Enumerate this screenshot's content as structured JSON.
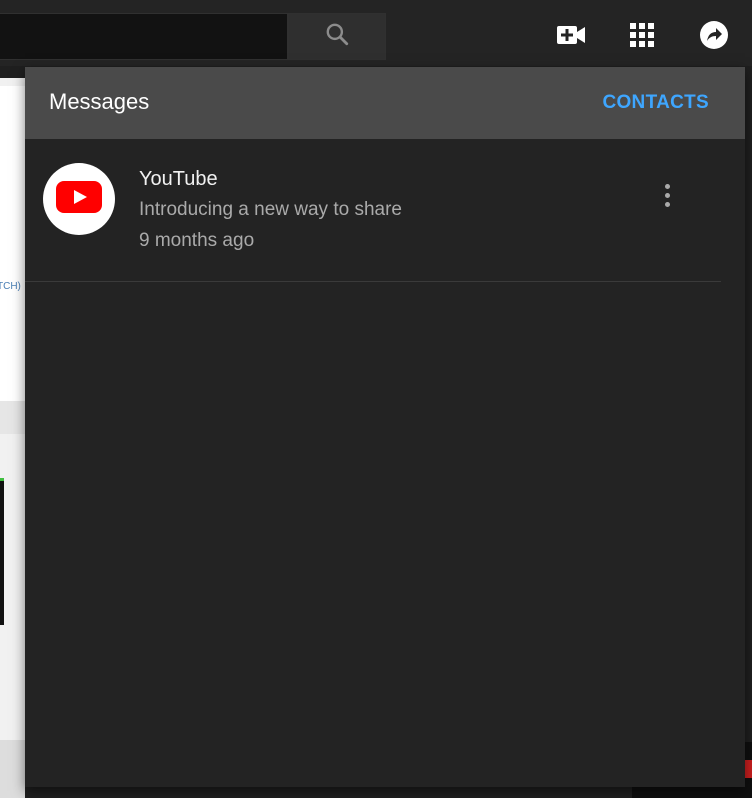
{
  "topbar": {
    "search_placeholder": "",
    "icons": [
      "search-icon",
      "create-video-icon",
      "apps-grid-icon",
      "share-arrow-icon"
    ]
  },
  "background": {
    "peek_text": "TCH)"
  },
  "messages_popup": {
    "title": "Messages",
    "contacts_label": "CONTACTS",
    "items": [
      {
        "sender": "YouTube",
        "preview": "Introducing a new way to share",
        "time": "9 months ago",
        "avatar_icon": "youtube-logo-icon"
      }
    ]
  },
  "colors": {
    "accent": "#3ea6ff",
    "youtube_red": "#ff0000",
    "header_bg": "#4a4a4a",
    "popup_bg": "#232323"
  }
}
